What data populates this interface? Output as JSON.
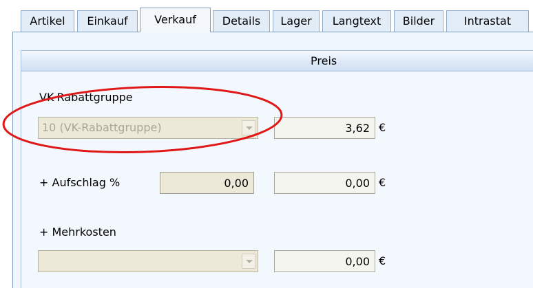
{
  "tabs": [
    {
      "label": "Artikel"
    },
    {
      "label": "Einkauf"
    },
    {
      "label": "Verkauf"
    },
    {
      "label": "Details"
    },
    {
      "label": "Lager"
    },
    {
      "label": "Langtext"
    },
    {
      "label": "Bilder"
    },
    {
      "label": "Intrastat"
    }
  ],
  "active_tab": "Verkauf",
  "group": {
    "title": "Preis"
  },
  "rabattgruppe": {
    "label": "VK-Rabattgruppe",
    "combo_value": "10 (VK-Rabattgruppe)",
    "amount": "3,62",
    "currency": "€"
  },
  "aufschlag": {
    "label": "+ Aufschlag %",
    "percent": "0,00",
    "amount": "0,00",
    "currency": "€"
  },
  "mehrkosten": {
    "label": "+ Mehrkosten",
    "combo_value": "",
    "amount": "0,00",
    "currency": "€"
  },
  "colors": {
    "highlight_circle": "#e01818",
    "tab_border": "#7f9dc4",
    "disabled_field": "#ece9d8"
  },
  "icons": [
    "chevron-down-icon"
  ]
}
